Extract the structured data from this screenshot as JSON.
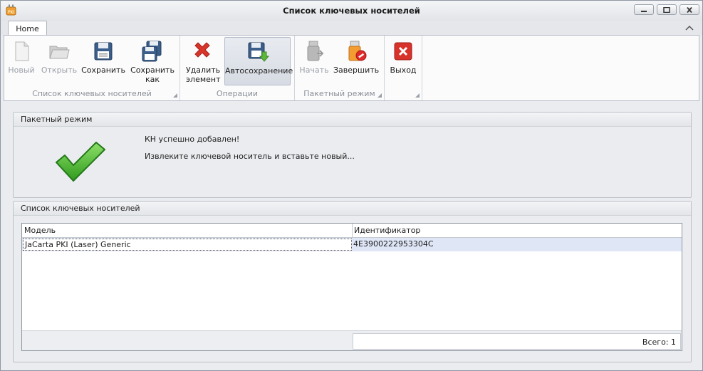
{
  "window": {
    "title": "Список ключевых носителей"
  },
  "tabs": [
    {
      "label": "Home"
    }
  ],
  "ribbon": {
    "groups": [
      {
        "caption": "Список ключевых носителей",
        "buttons": [
          {
            "label": "Новый",
            "icon": "new-document-icon",
            "enabled": false
          },
          {
            "label": "Открыть",
            "icon": "open-folder-icon",
            "enabled": false
          },
          {
            "label": "Сохранить",
            "icon": "floppy-disk-icon",
            "enabled": true
          },
          {
            "label": "Сохранить как",
            "icon": "floppy-save-as-icon",
            "enabled": true
          }
        ]
      },
      {
        "caption": "Операции",
        "buttons": [
          {
            "label": "Удалить элемент",
            "icon": "red-x-delete-icon",
            "enabled": true
          },
          {
            "label": "Автосохранение",
            "icon": "floppy-autosave-icon",
            "enabled": true,
            "active": true
          }
        ]
      },
      {
        "caption": "Пакетный режим",
        "buttons": [
          {
            "label": "Начать",
            "icon": "usb-token-start-icon",
            "enabled": false
          },
          {
            "label": "Завершить",
            "icon": "usb-token-stop-icon",
            "enabled": true
          }
        ]
      },
      {
        "caption": "",
        "buttons": [
          {
            "label": "Выход",
            "icon": "exit-x-icon",
            "enabled": true
          }
        ]
      }
    ]
  },
  "batch_panel": {
    "title": "Пакетный режим",
    "message_success": "КН успешно добавлен!",
    "message_instruction": "Извлеките ключевой носитель и вставьте новый...",
    "icon": "green-checkmark-icon"
  },
  "list_panel": {
    "title": "Список ключевых носителей",
    "columns": [
      "Модель",
      "Идентификатор"
    ],
    "rows": [
      {
        "model": "JaCarta PKI (Laser) Generic",
        "id": "4E3900222953304C"
      }
    ],
    "total_text": "Всего: 1"
  },
  "colors": {
    "selected_row": "#dfe7f7",
    "delete_red": "#d9362b",
    "check_green": "#3fae2a"
  }
}
